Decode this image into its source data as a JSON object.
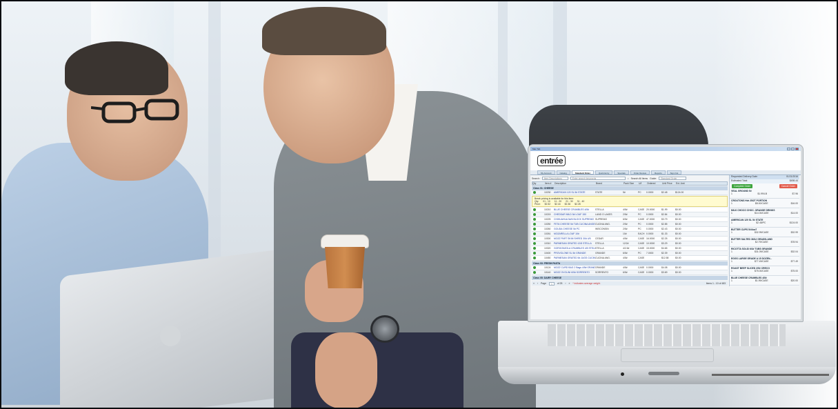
{
  "scene": {
    "description_icons": [
      "person-left",
      "person-right",
      "coffee-cup",
      "background-laptop",
      "foreground-laptop"
    ]
  },
  "app": {
    "title": "Mac Tab",
    "brand": "entrée",
    "tabs": [
      {
        "label": "My Account"
      },
      {
        "label": "Catalog"
      },
      {
        "label": "Standard Order"
      },
      {
        "label": "Quick Entry"
      },
      {
        "label": "Specials"
      },
      {
        "label": "Order Review"
      },
      {
        "label": "Reports"
      },
      {
        "label": "Sign Out"
      }
    ],
    "search": {
      "label": "Search:",
      "mode": "Item Descriptions",
      "placeholder": "Enter search keywords",
      "all_items": "Search All Items",
      "guide_label": "Guide:",
      "guide_value": "Standard Order"
    },
    "columns": [
      "Qty",
      "Item #",
      "Description",
      "Brand",
      "Pack Size",
      "U/I",
      "Ordered",
      "Unit Price",
      "Ext. Amt"
    ],
    "section1": "Class 01: CHEESE",
    "rows1": [
      {
        "qty": "",
        "item": "10230",
        "desc": "AMERICAN 120 SL 5# STATE",
        "brand": "STATE",
        "pack": "5#",
        "ui": "PC",
        "ordered": "0.0000",
        "unit": "$2.48",
        "ext": "$124.00"
      }
    ],
    "pricing": {
      "note": "Break pricing is available for this item:",
      "qty_label": "Qty:",
      "price_label": "Price:",
      "tiers": [
        {
          "qty": "01 - 10",
          "price": "$2.52"
        },
        {
          "qty": "11 - 20",
          "price": "$2.44"
        },
        {
          "qty": "21 - 30",
          "price": "$2.36"
        },
        {
          "qty": "31 - 40",
          "price": "$2.28"
        }
      ]
    },
    "rows2": [
      {
        "item": "10210",
        "desc": "BLUE CHEESE CRUMBLES 4/5#",
        "brand": "STELLA",
        "pack": "4/5#",
        "ui": "CASE",
        "ordered": "20.0000",
        "unit": "$1.99",
        "ext": "$0.00"
      },
      {
        "item": "10215",
        "desc": "CHEDDAR MILD 5# LOAF 150",
        "brand": "LAND O LAKES",
        "pack": "2/5#",
        "ui": "PC",
        "ordered": "0.0000",
        "unit": "$2.84",
        "ext": "$0.00"
      },
      {
        "item": "10225",
        "desc": "CHIHUAHUA 5#/6 BLOCK SUPREMO",
        "brand": "SUPREMO",
        "pack": "6/5#",
        "ui": "CASE",
        "ordered": "47.0000",
        "unit": "$3.79",
        "ext": "$0.00"
      },
      {
        "item": "10250",
        "desc": "FETA CHEESE 5# TUB CUCINA ANGELINA",
        "brand": "CUCINA ANG.",
        "pack": "2/5#",
        "ui": "PC",
        "ordered": "0.0000",
        "unit": "$2.85",
        "ext": "$0.00"
      },
      {
        "item": "10260",
        "desc": "GOUDA CHEESE 5# PC",
        "brand": "WISCONSIN",
        "pack": "2/5#",
        "ui": "PC",
        "ordered": "0.0000",
        "unit": "$2.43",
        "ext": "$0.00"
      },
      {
        "item": "10261",
        "desc": "MOZARELLA LOAF 10#",
        "brand": "",
        "pack": "10#",
        "ui": "EACH",
        "ordered": "0.0000",
        "unit": "$1.33",
        "ext": "$0.00"
      },
      {
        "item": "10300",
        "desc": "MOZZ PART SKIM SHRED 30# 4/5",
        "brand": "CEDAR",
        "pack": "4/5#",
        "ui": "CASE",
        "ordered": "16.0000",
        "unit": "$2.25",
        "ext": "$0.00"
      },
      {
        "item": "10310",
        "desc": "PARMESAN GRATED 12/8 STELLA",
        "brand": "STELLA",
        "pack": "12/2#",
        "ui": "CASE",
        "ordered": "10.0000",
        "unit": "$3.29",
        "ext": "$0.00"
      },
      {
        "item": "10320",
        "desc": "GORGONZOLA CRUMBLES 4/5 STELLA",
        "brand": "STELLA",
        "pack": "4/2.5#",
        "ui": "CASE",
        "ordered": "15.0000",
        "unit": "$4.65",
        "ext": "$0.00"
      },
      {
        "item": "10400",
        "desc": "PROVOLONE SL 5# GRANDE",
        "brand": "GRANDE",
        "pack": "6/5#",
        "ui": "PC",
        "ordered": "7.0000",
        "unit": "$2.39",
        "ext": "$0.00"
      },
      {
        "item": "10450",
        "desc": "PARMESAN GRATED 5# JUGS CUCINA",
        "brand": "CUCINA ANG.",
        "pack": "4/5#",
        "ui": "CASE",
        "ordered": "",
        "unit": "$12.58",
        "ext": "$0.00"
      }
    ],
    "section2": "Class 03: FRESH PASTA",
    "rows3": [
      {
        "item": "10124",
        "desc": "MOZZ CURD BAG 2 Bags 4/5# GRANDE",
        "brand": "GRANDE",
        "pack": "4/5#",
        "ui": "CASE",
        "ordered": "0.0000",
        "unit": "$4.08",
        "ext": "$0.00"
      },
      {
        "item": "10140",
        "desc": "MOZZ OVOLINI 6/5# SORRENTO",
        "brand": "SORRENTO",
        "pack": "6/5#",
        "ui": "CASE",
        "ordered": "0.0000",
        "unit": "$3.69",
        "ext": "$0.00"
      }
    ],
    "section3": "Class 05: DAIRY CHEESE",
    "pager": {
      "page_label": "Page",
      "page": "1",
      "of": "of 25",
      "note": "* indicates average weight.",
      "items": "Items 1 - 10 of 483"
    },
    "summary": {
      "delivery_label": "Requested Delivery Date:",
      "delivery_date": "01/21/2016",
      "total_label": "Estimated Total:",
      "total": "$498.44",
      "complete": "Complete Order",
      "cancel": "Cancel Order",
      "items": [
        {
          "name": "VEAL GROUND 5#",
          "qty": "1",
          "price": "$1.99/LB",
          "ext": "$7.96"
        },
        {
          "name": "CROUTONS Hdr 25/2T PORTION",
          "qty": "1",
          "price": "$8.00/CASE",
          "ext": "$16.00"
        },
        {
          "name": "MILK CHOCO CHOC. ORANGE DRINKS",
          "qty": "1",
          "price": "$14.00/CASE",
          "ext": "$14.00"
        },
        {
          "name": "AMERICAN 120 SL 5# STATE",
          "qty": "1",
          "price": "$2.48/PC",
          "ext": "$124.00"
        },
        {
          "name": "BUTTER CUPS 5#/4oz7",
          "qty": "1",
          "price": "$32.99/CASE",
          "ext": "$32.99"
        },
        {
          "name": "BUTTER SALTED 36/1# GRASSLAND",
          "qty": "1",
          "price": "$2.79/CASE",
          "ext": "$78.94"
        },
        {
          "name": "RICOTTA SOLID 6/3# TUBS GRANDE",
          "qty": "1",
          "price": "$31.09/CASE",
          "ext": "$32.04"
        },
        {
          "name": "EGGS LARGE GRADE A 15 DOZEN...",
          "qty": "1",
          "price": "$77.49/CASE",
          "ext": "$77.49"
        },
        {
          "name": "ROAST BEEF SLICED 2/5# CRECO",
          "qty": "1",
          "price": "$75.00/CASE",
          "ext": "$75.00"
        },
        {
          "name": "BLUE CHEESE CRUMBLES 4/5#",
          "qty": "1",
          "price": "$1.99/CASE",
          "ext": "$20.00"
        }
      ]
    }
  }
}
